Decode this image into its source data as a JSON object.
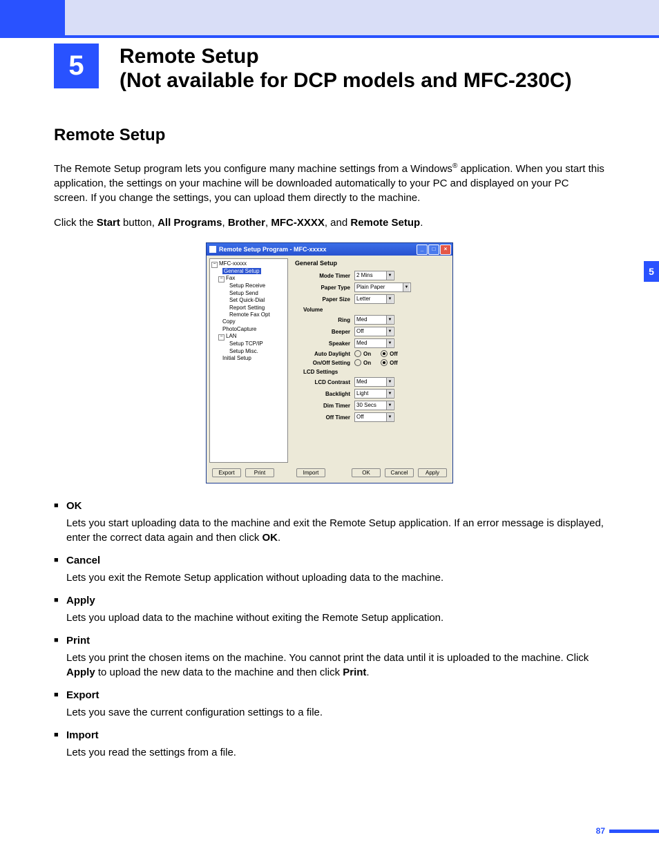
{
  "chapter": {
    "number": "5",
    "title_line1": "Remote Setup",
    "title_line2": "(Not available for DCP models and MFC-230C)"
  },
  "section_heading": "Remote Setup",
  "intro_p1a": "The Remote Setup program lets you configure many machine settings from a Windows",
  "intro_p1b": " application. When you start this application, the settings on your machine will be downloaded automatically to your PC and displayed on your PC screen. If you change the settings, you can upload them directly to the machine.",
  "intro_p2_prefix": "Click the ",
  "intro_p2_parts": {
    "start": "Start",
    "sep1": " button, ",
    "all_programs": "All Programs",
    "sep2": ", ",
    "brother": "Brother",
    "sep3": ", ",
    "mfc": "MFC-XXXX",
    "sep4": ", and ",
    "remote_setup": "Remote Setup",
    "end": "."
  },
  "app": {
    "title": "Remote Setup Program - MFC-xxxxx",
    "win_btns": {
      "min": "_",
      "max": "□",
      "close": "×"
    },
    "tree": {
      "root": "MFC-xxxxx",
      "general": "General Setup",
      "fax": "Fax",
      "fax_children": [
        "Setup Receive",
        "Setup Send",
        "Set Quick-Dial",
        "Report Setting",
        "Remote Fax Opt"
      ],
      "copy": "Copy",
      "photo": "PhotoCapture",
      "lan": "LAN",
      "lan_children": [
        "Setup TCP/IP",
        "Setup Misc."
      ],
      "initial": "Initial Setup"
    },
    "panel": {
      "heading": "General Setup",
      "mode_timer": {
        "label": "Mode Timer",
        "value": "2 Mins"
      },
      "paper_type": {
        "label": "Paper Type",
        "value": "Plain Paper"
      },
      "paper_size": {
        "label": "Paper Size",
        "value": "Letter"
      },
      "volume_heading": "Volume",
      "ring": {
        "label": "Ring",
        "value": "Med"
      },
      "beeper": {
        "label": "Beeper",
        "value": "Off"
      },
      "speaker": {
        "label": "Speaker",
        "value": "Med"
      },
      "auto_daylight": {
        "label": "Auto Daylight",
        "on": "On",
        "off": "Off",
        "selected": "off"
      },
      "onoff": {
        "label": "On/Off Setting",
        "on": "On",
        "off": "Off",
        "selected": "off"
      },
      "lcd_heading": "LCD Settings",
      "lcd_contrast": {
        "label": "LCD Contrast",
        "value": "Med"
      },
      "backlight": {
        "label": "Backlight",
        "value": "Light"
      },
      "dim_timer": {
        "label": "Dim Timer",
        "value": "30 Secs"
      },
      "off_timer": {
        "label": "Off Timer",
        "value": "Off"
      }
    },
    "buttons": {
      "export": "Export",
      "print": "Print",
      "import": "Import",
      "ok": "OK",
      "cancel": "Cancel",
      "apply": "Apply"
    }
  },
  "descriptions": [
    {
      "term": "OK",
      "def_a": "Lets you start uploading data to the machine and exit the Remote Setup application. If an error message is displayed, enter the correct data again and then click ",
      "def_bold": "OK",
      "def_b": "."
    },
    {
      "term": "Cancel",
      "def_a": "Lets you exit the Remote Setup application without uploading data to the machine.",
      "def_bold": "",
      "def_b": ""
    },
    {
      "term": "Apply",
      "def_a": "Lets you upload data to the machine without exiting the Remote Setup application.",
      "def_bold": "",
      "def_b": ""
    },
    {
      "term": "Print",
      "def_a": "Lets you print the chosen items on the machine. You cannot print the data until it is uploaded to the machine. Click ",
      "def_bold": "Apply",
      "def_b": " to upload the new data to the machine and then click ",
      "def_bold2": "Print",
      "def_c": "."
    },
    {
      "term": "Export",
      "def_a": "Lets you save the current configuration settings to a file.",
      "def_bold": "",
      "def_b": ""
    },
    {
      "term": "Import",
      "def_a": "Lets you read the settings from a file.",
      "def_bold": "",
      "def_b": ""
    }
  ],
  "side_tab": "5",
  "page_number": "87"
}
